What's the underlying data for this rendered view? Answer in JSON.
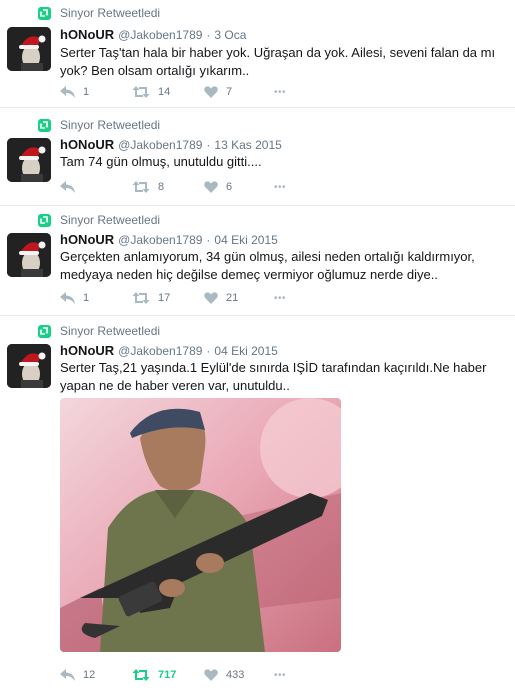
{
  "colors": {
    "retweet_green": "#19cf86",
    "meta_gray": "#657786",
    "icon_gray": "#aab8c2",
    "divider": "#e6ecf0"
  },
  "tweets": [
    {
      "retweeted_by": "Sinyor Retweetledi",
      "name": "hONoUR",
      "handle": "@Jakoben1789",
      "sep": "·",
      "time": "3 Oca",
      "text": "Serter Taş'tan hala bir haber yok. Uğraşan da yok. Ailesi, seveni falan da mı yok? Ben olsam ortalığı yıkarım..",
      "replies": "1",
      "retweets": "14",
      "likes": "7",
      "more": "•••"
    },
    {
      "retweeted_by": "Sinyor Retweetledi",
      "name": "hONoUR",
      "handle": "@Jakoben1789",
      "sep": "·",
      "time": "13 Kas 2015",
      "text": "Tam 74 gün olmuş, unutuldu gitti....",
      "replies": "",
      "retweets": "8",
      "likes": "6",
      "more": "•••"
    },
    {
      "retweeted_by": "Sinyor Retweetledi",
      "name": "hONoUR",
      "handle": "@Jakoben1789",
      "sep": "·",
      "time": "04 Eki 2015",
      "text": "Gerçekten anlamıyorum, 34 gün olmuş, ailesi neden ortalığı kaldırmıyor, medyaya neden hiç değilse demeç vermiyor oğlumuz nerde diye..",
      "replies": "1",
      "retweets": "17",
      "likes": "21",
      "more": "•••"
    },
    {
      "retweeted_by": "Sinyor Retweetledi",
      "name": "hONoUR",
      "handle": "@Jakoben1789",
      "sep": "·",
      "time": "04 Eki 2015",
      "text": "Serter Taş,21 yaşında.1 Eylül'de sınırda IŞİD tarafından kaçırıldı.Ne haber yapan ne de haber veren var, unutuldu..",
      "replies": "12",
      "retweets": "717",
      "likes": "433",
      "more": "•••",
      "retweeted_state": true
    }
  ]
}
